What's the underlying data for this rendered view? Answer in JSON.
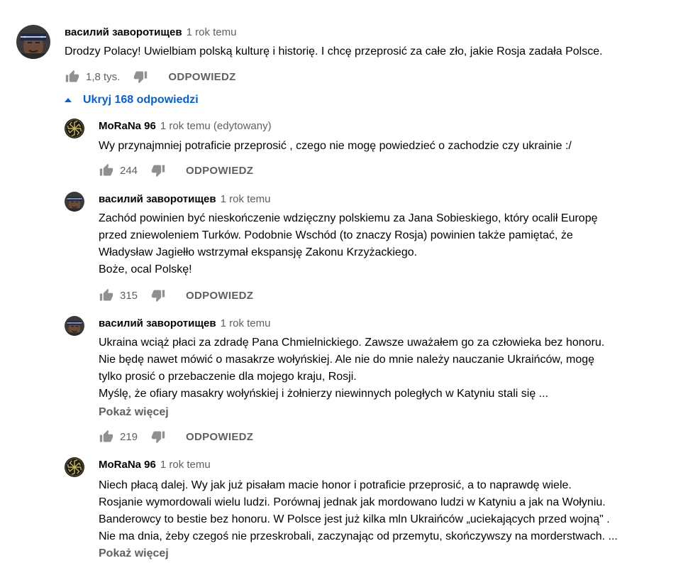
{
  "top_comment": {
    "author": "василий заворотищев",
    "time": "1 rok temu",
    "text": "Drodzy Polacy! Uwielbiam polską kulturę i historię. I chcę przeprosić za całe zło, jakie Rosja zadała Polsce.",
    "likes": "1,8 tys.",
    "reply_label": "ODPOWIEDZ",
    "avatar_icon": "bandana-man-avatar"
  },
  "replies_toggle": {
    "label": "Ukryj 168 odpowiedzi",
    "icon": "caret-up-icon"
  },
  "replies": [
    {
      "author": "MoRaNa 96",
      "time": "1 rok temu (edytowany)",
      "text": "Wy przynajmniej potraficie przeprosić , czego nie mogę powiedzieć o zachodzie czy ukrainie :/",
      "likes": "244",
      "reply_label": "ODPOWIEDZ",
      "show_more": "",
      "avatar_icon": "kolovrat-avatar"
    },
    {
      "author": "василий заворотищев",
      "time": "1 rok temu",
      "text": "Zachód powinien być nieskończenie wdzięczny polskiemu za Jana Sobieskiego, który ocalił Europę\nprzed zniewoleniem Turków. Podobnie Wschód (to znaczy Rosja) powinien także pamiętać, że\nWładysław Jagiełło wstrzymał ekspansję Zakonu Krzyżackiego.\nBoże, ocal Polskę!",
      "likes": "315",
      "reply_label": "ODPOWIEDZ",
      "show_more": "",
      "avatar_icon": "bandana-man-avatar"
    },
    {
      "author": "василий заворотищев",
      "time": "1 rok temu",
      "text": "Ukraina wciąż płaci za zdradę Pana Chmielnickiego. Zawsze uważałem go za człowieka bez honoru.\nNie będę nawet mówić o masakrze wołyńskiej. Ale nie do mnie należy nauczanie Ukraińców, mogę\ntylko prosić o przebaczenie dla mojego kraju, Rosji.\n Myślę, że ofiary masakry wołyńskiej i żołnierzy niewinnych poległych w Katyniu stali się ...",
      "likes": "219",
      "reply_label": "ODPOWIEDZ",
      "show_more": "Pokaż więcej",
      "avatar_icon": "bandana-man-avatar"
    },
    {
      "author": "MoRaNa 96",
      "time": "1 rok temu",
      "text": "Niech płacą dalej. Wy jak już pisałam macie honor i potraficie przeprosić, a to naprawdę wiele.\nRosjanie wymordowali wielu ludzi. Porównaj jednak jak mordowano ludzi w Katyniu a jak na Wołyniu.\nBanderowcy to bestie bez honoru. W Polsce jest już kilka mln Ukraińców „uciekających przed wojną\" .\nNie ma dnia, żeby czegoś nie przeskrobali, zaczynając od przemytu, skończywszy na morderstwach. ...",
      "likes": "",
      "reply_label": "",
      "show_more": "Pokaż więcej",
      "avatar_icon": "kolovrat-avatar"
    }
  ],
  "colors": {
    "text": "#030303",
    "secondary": "#606060",
    "link": "#065fd4"
  }
}
